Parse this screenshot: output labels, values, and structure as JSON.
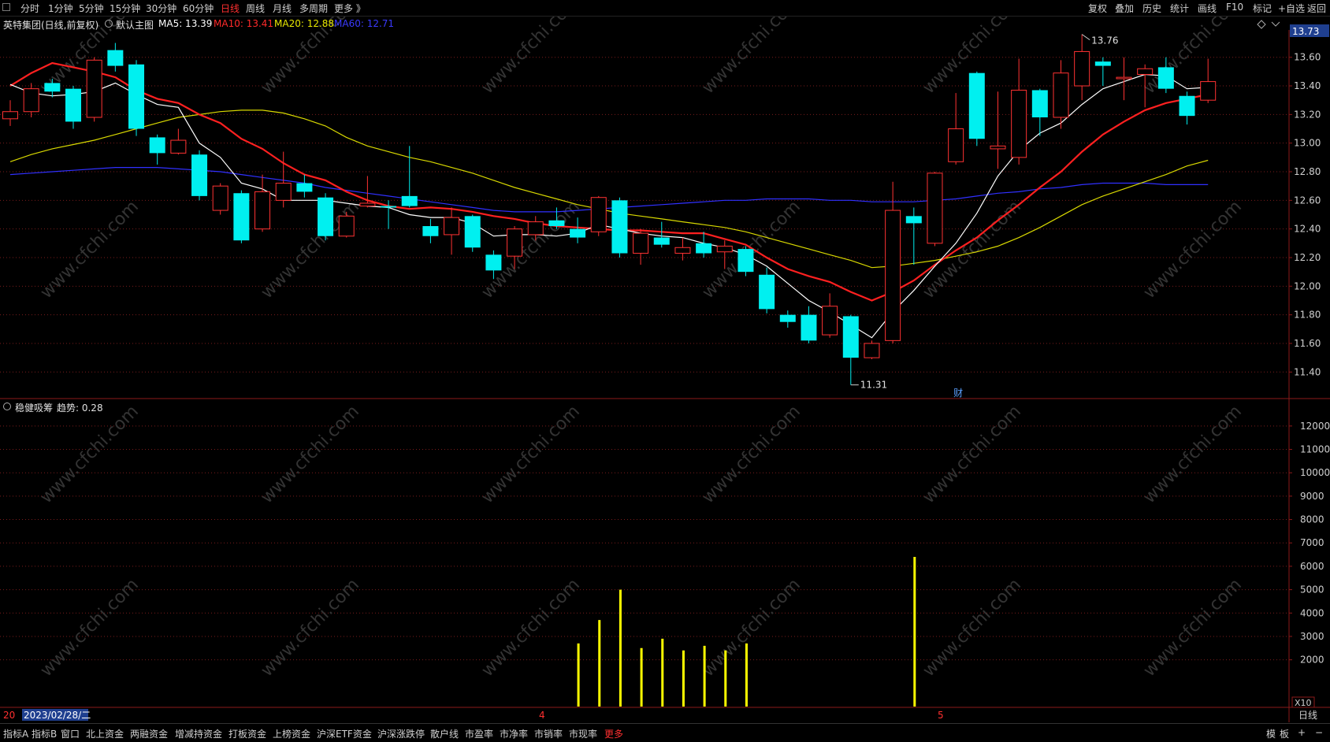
{
  "toolbar": {
    "period_tabs": [
      "分时",
      "1分钟",
      "5分钟",
      "15分钟",
      "30分钟",
      "60分钟",
      "日线",
      "周线",
      "月线",
      "多周期",
      "更多 》"
    ],
    "active_period": "日线",
    "right_tabs": [
      "复权",
      "叠加",
      "历史",
      "统计",
      "画线",
      "F10",
      "标记",
      "+自选",
      "返回"
    ]
  },
  "main_panel": {
    "stock_name": "英特集团(日线,前复权)",
    "indicator_name": "默认主图",
    "ma": [
      {
        "label": "MA5: 13.39",
        "color": "#ffffff"
      },
      {
        "label": "MA10: 13.41",
        "color": "#ff2a2a"
      },
      {
        "label": "MA20: 12.88",
        "color": "#e8e800"
      },
      {
        "label": "MA60: 12.71",
        "color": "#3a3aff"
      }
    ],
    "current_price_tag": "13.73",
    "high_label": "13.76",
    "low_label": "11.31",
    "finance_marker": "财",
    "price_ticks": [
      "13.60",
      "13.40",
      "13.20",
      "13.00",
      "12.80",
      "12.60",
      "12.40",
      "12.20",
      "12.00",
      "11.80",
      "11.60",
      "11.40"
    ]
  },
  "sub_panel": {
    "title": "稳健吸筹",
    "trend_label": "趋势: 0.28",
    "ticks": [
      "12000",
      "11000",
      "10000",
      "9000",
      "8000",
      "7000",
      "6000",
      "5000",
      "4000",
      "3000",
      "2000"
    ],
    "scale_label": "X10"
  },
  "x_axis": {
    "date_cursor": "2023/02/28/二",
    "date_cursor_prefix": "20",
    "month_labels": [
      "4",
      "5"
    ],
    "period_label": "日线"
  },
  "watermark": "www.cfchi.com",
  "bottom_tabs": [
    "指标A",
    "指标B",
    "窗口",
    "北上资金",
    "两融资金",
    "增减持资金",
    "打板资金",
    "上榜资金",
    "沪深ETF资金",
    "沪深涨跌停",
    "散户线",
    "市盈率",
    "市净率",
    "市销率",
    "市现率",
    "更多"
  ],
  "bottom_right": [
    "模",
    "板",
    "+",
    "−"
  ],
  "chart_data": {
    "type": "candlestick",
    "price_range": [
      11.22,
      13.78
    ],
    "candles": [
      {
        "o": 13.17,
        "c": 13.22,
        "h": 13.3,
        "l": 13.12
      },
      {
        "o": 13.22,
        "c": 13.38,
        "h": 13.42,
        "l": 13.18
      },
      {
        "o": 13.42,
        "c": 13.36,
        "h": 13.45,
        "l": 13.32
      },
      {
        "o": 13.38,
        "c": 13.15,
        "h": 13.4,
        "l": 13.1
      },
      {
        "o": 13.18,
        "c": 13.58,
        "h": 13.6,
        "l": 13.15
      },
      {
        "o": 13.65,
        "c": 13.54,
        "h": 13.7,
        "l": 13.5
      },
      {
        "o": 13.55,
        "c": 13.1,
        "h": 13.58,
        "l": 13.05
      },
      {
        "o": 13.04,
        "c": 12.93,
        "h": 13.06,
        "l": 12.85
      },
      {
        "o": 12.93,
        "c": 13.02,
        "h": 13.1,
        "l": 12.92
      },
      {
        "o": 12.92,
        "c": 12.63,
        "h": 12.95,
        "l": 12.6
      },
      {
        "o": 12.53,
        "c": 12.7,
        "h": 12.72,
        "l": 12.5
      },
      {
        "o": 12.65,
        "c": 12.32,
        "h": 12.67,
        "l": 12.3
      },
      {
        "o": 12.4,
        "c": 12.66,
        "h": 12.78,
        "l": 12.38
      },
      {
        "o": 12.6,
        "c": 12.72,
        "h": 12.94,
        "l": 12.55
      },
      {
        "o": 12.72,
        "c": 12.66,
        "h": 12.78,
        "l": 12.62
      },
      {
        "o": 12.62,
        "c": 12.35,
        "h": 12.65,
        "l": 12.32
      },
      {
        "o": 12.35,
        "c": 12.49,
        "h": 12.52,
        "l": 12.34
      },
      {
        "o": 12.56,
        "c": 12.58,
        "h": 12.77,
        "l": 12.55
      },
      {
        "o": 12.56,
        "c": 12.55,
        "h": 12.6,
        "l": 12.4
      },
      {
        "o": 12.63,
        "c": 12.56,
        "h": 12.98,
        "l": 12.55
      },
      {
        "o": 12.42,
        "c": 12.35,
        "h": 12.47,
        "l": 12.3
      },
      {
        "o": 12.36,
        "c": 12.48,
        "h": 12.55,
        "l": 12.22
      },
      {
        "o": 12.49,
        "c": 12.27,
        "h": 12.5,
        "l": 12.24
      },
      {
        "o": 12.22,
        "c": 12.11,
        "h": 12.25,
        "l": 12.05
      },
      {
        "o": 12.21,
        "c": 12.4,
        "h": 12.42,
        "l": 12.12
      },
      {
        "o": 12.36,
        "c": 12.45,
        "h": 12.49,
        "l": 12.32
      },
      {
        "o": 12.46,
        "c": 12.42,
        "h": 12.55,
        "l": 12.4
      },
      {
        "o": 12.4,
        "c": 12.34,
        "h": 12.48,
        "l": 12.3
      },
      {
        "o": 12.38,
        "c": 12.62,
        "h": 12.63,
        "l": 12.35
      },
      {
        "o": 12.6,
        "c": 12.23,
        "h": 12.62,
        "l": 12.2
      },
      {
        "o": 12.23,
        "c": 12.37,
        "h": 12.4,
        "l": 12.15
      },
      {
        "o": 12.34,
        "c": 12.29,
        "h": 12.45,
        "l": 12.27
      },
      {
        "o": 12.23,
        "c": 12.27,
        "h": 12.34,
        "l": 12.18
      },
      {
        "o": 12.3,
        "c": 12.23,
        "h": 12.38,
        "l": 12.2
      },
      {
        "o": 12.24,
        "c": 12.28,
        "h": 12.32,
        "l": 12.12
      },
      {
        "o": 12.26,
        "c": 12.1,
        "h": 12.28,
        "l": 12.07
      },
      {
        "o": 12.08,
        "c": 11.84,
        "h": 12.13,
        "l": 11.81
      },
      {
        "o": 11.8,
        "c": 11.75,
        "h": 11.83,
        "l": 11.71
      },
      {
        "o": 11.8,
        "c": 11.62,
        "h": 11.86,
        "l": 11.6
      },
      {
        "o": 11.66,
        "c": 11.86,
        "h": 11.95,
        "l": 11.64
      },
      {
        "o": 11.79,
        "c": 11.5,
        "h": 11.8,
        "l": 11.31
      },
      {
        "o": 11.5,
        "c": 11.6,
        "h": 11.62,
        "l": 11.49
      },
      {
        "o": 11.62,
        "c": 12.53,
        "h": 12.73,
        "l": 11.6
      },
      {
        "o": 12.49,
        "c": 12.44,
        "h": 12.55,
        "l": 12.15
      },
      {
        "o": 12.3,
        "c": 12.79,
        "h": 12.8,
        "l": 12.28
      },
      {
        "o": 12.87,
        "c": 13.1,
        "h": 13.35,
        "l": 12.85
      },
      {
        "o": 13.49,
        "c": 13.03,
        "h": 13.5,
        "l": 12.98
      },
      {
        "o": 12.96,
        "c": 12.98,
        "h": 13.36,
        "l": 12.82
      },
      {
        "o": 12.9,
        "c": 13.37,
        "h": 13.59,
        "l": 12.85
      },
      {
        "o": 13.37,
        "c": 13.18,
        "h": 13.38,
        "l": 13.05
      },
      {
        "o": 13.18,
        "c": 13.49,
        "h": 13.58,
        "l": 13.1
      },
      {
        "o": 13.4,
        "c": 13.64,
        "h": 13.76,
        "l": 13.3
      },
      {
        "o": 13.57,
        "c": 13.54,
        "h": 13.6,
        "l": 13.4
      },
      {
        "o": 13.45,
        "c": 13.46,
        "h": 13.6,
        "l": 13.3
      },
      {
        "o": 13.48,
        "c": 13.52,
        "h": 13.55,
        "l": 13.25
      },
      {
        "o": 13.53,
        "c": 13.38,
        "h": 13.6,
        "l": 13.35
      },
      {
        "o": 13.33,
        "c": 13.19,
        "h": 13.36,
        "l": 13.13
      },
      {
        "o": 13.3,
        "c": 13.43,
        "h": 13.59,
        "l": 13.28
      }
    ],
    "ma5": [
      13.41,
      13.35,
      13.33,
      13.34,
      13.36,
      13.42,
      13.34,
      13.27,
      13.25,
      13.0,
      12.9,
      12.72,
      12.68,
      12.6,
      12.6,
      12.6,
      12.58,
      12.56,
      12.55,
      12.5,
      12.48,
      12.48,
      12.44,
      12.35,
      12.36,
      12.36,
      12.35,
      12.37,
      12.43,
      12.4,
      12.37,
      12.35,
      12.34,
      12.3,
      12.27,
      12.22,
      12.14,
      12.02,
      11.9,
      11.82,
      11.73,
      11.64,
      11.82,
      11.97,
      12.14,
      12.3,
      12.51,
      12.77,
      12.95,
      13.07,
      13.14,
      13.27,
      13.38,
      13.43,
      13.48,
      13.47,
      13.38,
      13.39
    ],
    "ma10": [
      13.4,
      13.49,
      13.56,
      13.53,
      13.5,
      13.46,
      13.37,
      13.31,
      13.28,
      13.2,
      13.14,
      13.03,
      12.96,
      12.86,
      12.78,
      12.74,
      12.66,
      12.6,
      12.56,
      12.54,
      12.55,
      12.54,
      12.52,
      12.49,
      12.47,
      12.44,
      12.42,
      12.41,
      12.4,
      12.39,
      12.39,
      12.38,
      12.37,
      12.37,
      12.33,
      12.29,
      12.2,
      12.12,
      12.07,
      12.03,
      11.96,
      11.9,
      11.96,
      12.04,
      12.15,
      12.25,
      12.34,
      12.46,
      12.57,
      12.69,
      12.8,
      12.94,
      13.06,
      13.15,
      13.23,
      13.28,
      13.31,
      13.34
    ],
    "ma20": [
      12.87,
      12.92,
      12.96,
      12.99,
      13.02,
      13.06,
      13.1,
      13.14,
      13.18,
      13.2,
      13.22,
      13.23,
      13.23,
      13.21,
      13.17,
      13.12,
      13.04,
      12.98,
      12.94,
      12.9,
      12.87,
      12.83,
      12.79,
      12.74,
      12.69,
      12.65,
      12.61,
      12.57,
      12.54,
      12.51,
      12.49,
      12.47,
      12.45,
      12.43,
      12.41,
      12.38,
      12.34,
      12.3,
      12.26,
      12.22,
      12.18,
      12.13,
      12.14,
      12.16,
      12.18,
      12.21,
      12.24,
      12.28,
      12.34,
      12.41,
      12.49,
      12.57,
      12.63,
      12.68,
      12.73,
      12.78,
      12.84,
      12.88
    ],
    "ma60": [
      12.78,
      12.79,
      12.8,
      12.81,
      12.82,
      12.83,
      12.83,
      12.83,
      12.82,
      12.81,
      12.8,
      12.78,
      12.76,
      12.74,
      12.72,
      12.69,
      12.67,
      12.65,
      12.63,
      12.61,
      12.59,
      12.57,
      12.55,
      12.53,
      12.52,
      12.52,
      12.52,
      12.53,
      12.54,
      12.55,
      12.56,
      12.57,
      12.58,
      12.59,
      12.6,
      12.6,
      12.61,
      12.61,
      12.61,
      12.6,
      12.6,
      12.59,
      12.59,
      12.59,
      12.6,
      12.61,
      12.63,
      12.65,
      12.66,
      12.68,
      12.69,
      12.71,
      12.72,
      12.72,
      12.72,
      12.71,
      12.71,
      12.71
    ],
    "indicator_bars": [
      {
        "index": 27,
        "value": 2700
      },
      {
        "index": 28,
        "value": 3700
      },
      {
        "index": 29,
        "value": 5000
      },
      {
        "index": 30,
        "value": 2500
      },
      {
        "index": 31,
        "value": 2900
      },
      {
        "index": 32,
        "value": 2400
      },
      {
        "index": 33,
        "value": 2600
      },
      {
        "index": 34,
        "value": 2400
      },
      {
        "index": 35,
        "value": 2700
      },
      {
        "index": 43,
        "value": 6400
      }
    ],
    "indicator_range": [
      0,
      12500
    ]
  }
}
